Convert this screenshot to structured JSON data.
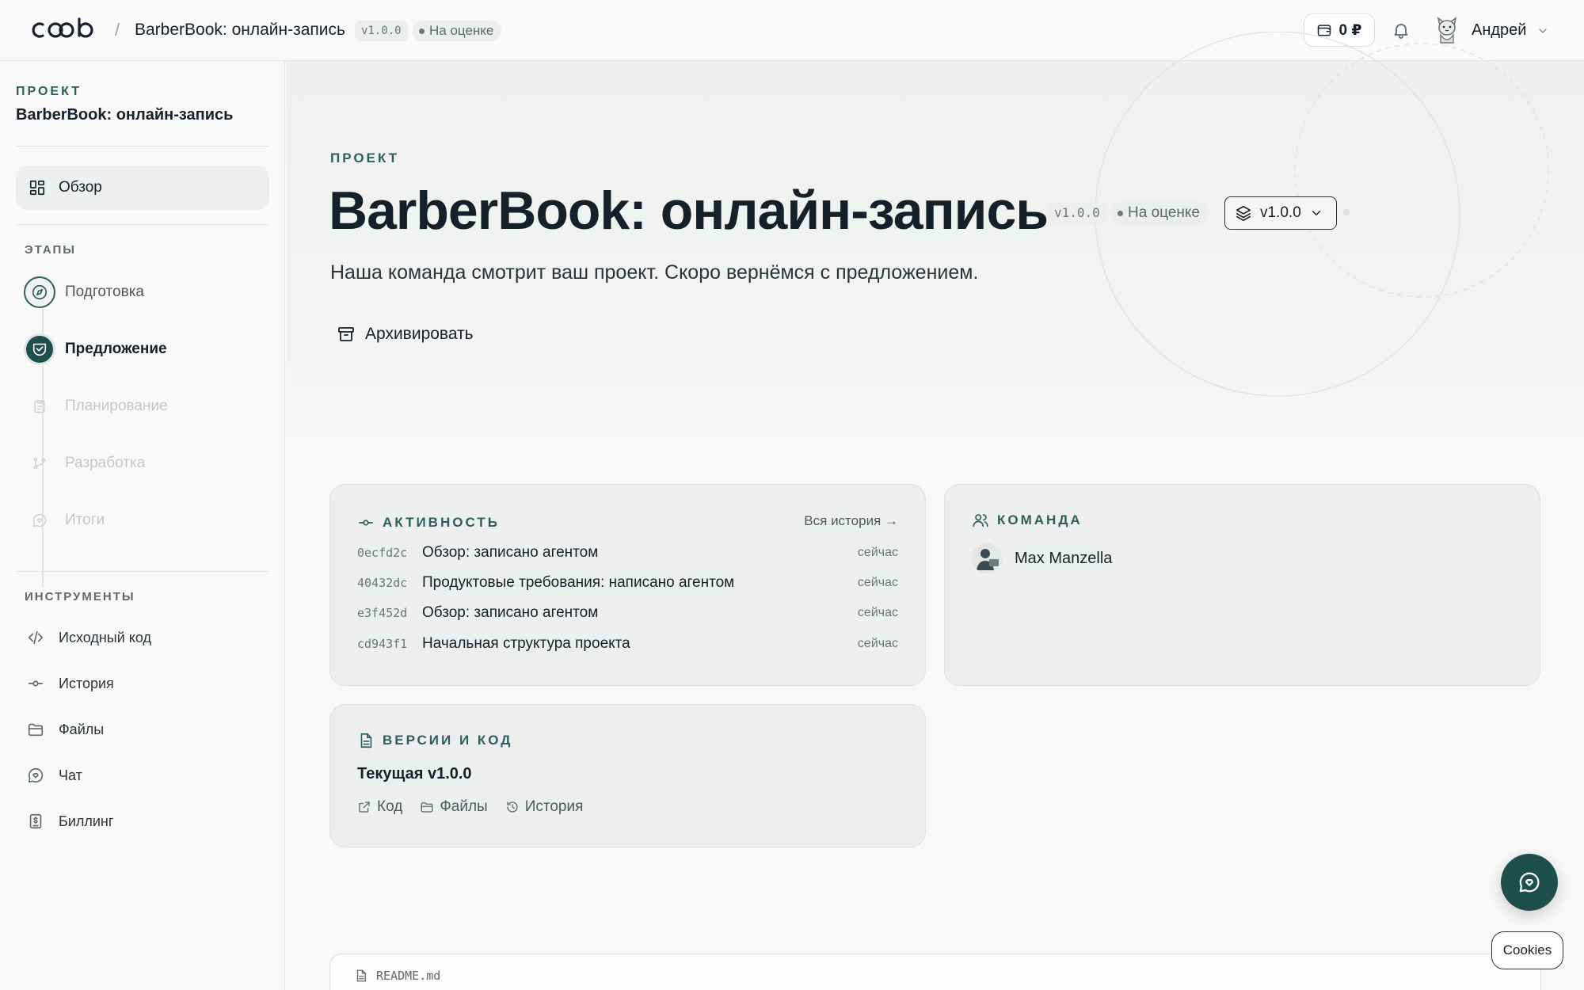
{
  "header": {
    "logo_alt": "coob",
    "breadcrumb_separator": "/",
    "project_title": "BarberBook: онлайн-запись",
    "version": "v1.0.0",
    "status": "На оценке",
    "balance": "0 ₽",
    "user_name": "Андрей"
  },
  "sidebar": {
    "eyebrow": "ПРОЕКТ",
    "project_name": "BarberBook: онлайн-запись",
    "overview_label": "Обзор",
    "stages_title": "ЭТАПЫ",
    "stages": [
      {
        "label": "Подготовка",
        "state": "done",
        "icon": "compass-icon"
      },
      {
        "label": "Предложение",
        "state": "active",
        "icon": "handshake-icon"
      },
      {
        "label": "Планирование",
        "state": "locked",
        "icon": "clipboard-icon"
      },
      {
        "label": "Разработка",
        "state": "locked",
        "icon": "git-branch-icon"
      },
      {
        "label": "Итоги",
        "state": "locked",
        "icon": "chat-heart-icon"
      }
    ],
    "tools_title": "ИНСТРУМЕНТЫ",
    "tools": [
      {
        "label": "Исходный код",
        "icon": "code-icon"
      },
      {
        "label": "История",
        "icon": "commit-icon"
      },
      {
        "label": "Файлы",
        "icon": "folder-icon"
      },
      {
        "label": "Чат",
        "icon": "chat-icon"
      },
      {
        "label": "Биллинг",
        "icon": "billing-icon"
      }
    ]
  },
  "main": {
    "eyebrow": "ПРОЕКТ",
    "title": "BarberBook: онлайн-запись",
    "version_chip": "v1.0.0",
    "status": "На оценке",
    "version_select": "v1.0.0",
    "subtitle": "Наша команда смотрит ваш проект. Скоро вернёмся с предложением.",
    "archive_label": "Архивировать"
  },
  "activity": {
    "title": "АКТИВНОСТЬ",
    "all_history": "Вся история →",
    "items": [
      {
        "hash": "0ecfd2c",
        "message": "Обзор: записано агентом",
        "time": "сейчас"
      },
      {
        "hash": "40432dc",
        "message": "Продуктовые требования: написано агентом",
        "time": "сейчас"
      },
      {
        "hash": "e3f452d",
        "message": "Обзор: записано агентом",
        "time": "сейчас"
      },
      {
        "hash": "cd943f1",
        "message": "Начальная структура проекта",
        "time": "сейчас"
      }
    ]
  },
  "team": {
    "title": "КОМАНДА",
    "members": [
      {
        "name": "Max Manzella"
      }
    ]
  },
  "versions": {
    "title": "ВЕРСИИ И КОД",
    "current": "Текущая v1.0.0",
    "links": {
      "code": "Код",
      "files": "Файлы",
      "history": "История"
    }
  },
  "readme": {
    "filename": "README.md"
  },
  "cookies_label": "Cookies",
  "colors": {
    "accent": "#2d5e5c",
    "accent_dark": "#1e4f4d",
    "background": "#f7f8f7",
    "card": "#edefee",
    "text": "#16202a"
  }
}
